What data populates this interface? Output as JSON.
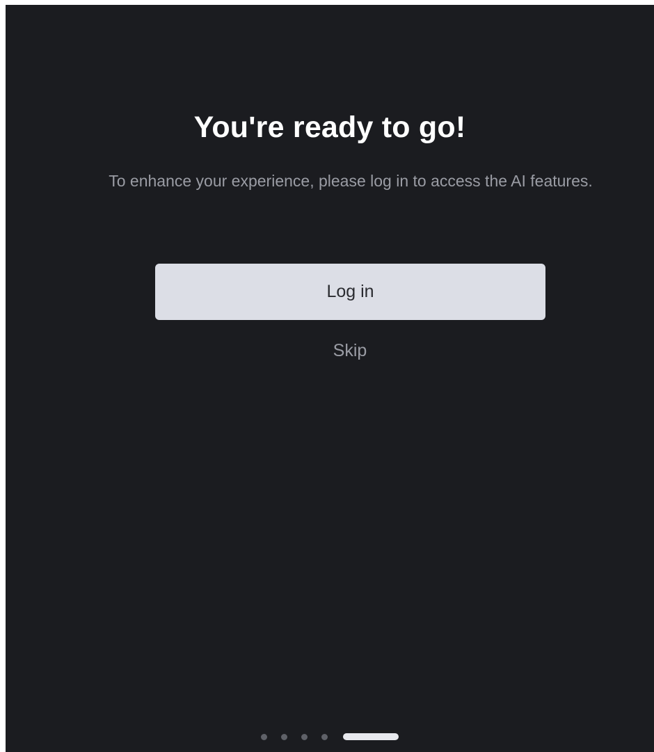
{
  "onboarding": {
    "title": "You're ready to go!",
    "subtitle": "To enhance your experience, please log in to access the AI features.",
    "login_label": "Log in",
    "skip_label": "Skip"
  },
  "pager": {
    "total_pages": 5,
    "current_page": 5
  },
  "colors": {
    "background": "#1b1c20",
    "title": "#ffffff",
    "muted_text": "#9a9ca4",
    "button_bg": "#dcdee6",
    "button_text": "#2a2b30",
    "dot_inactive": "#5f6168",
    "dot_active": "#e8e9ee"
  }
}
